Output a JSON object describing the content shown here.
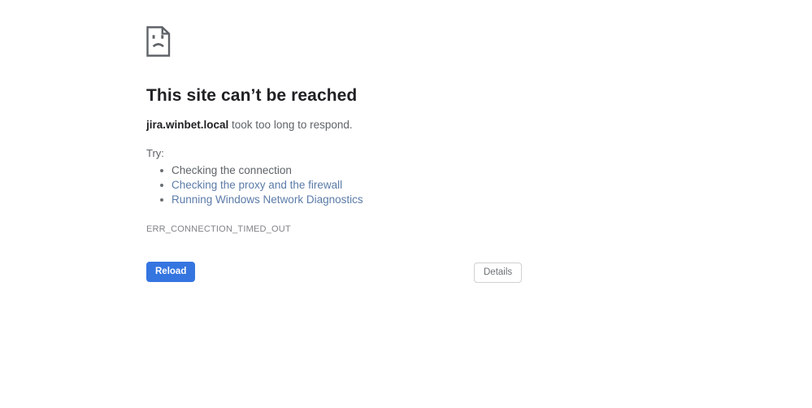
{
  "page": {
    "background_color": "#ffffff",
    "icon": {
      "name": "sad-page-icon",
      "color": "#5f6368"
    }
  },
  "error": {
    "heading": "This site can’t be reached",
    "host": "jira.winbet.local",
    "reason": " took too long to respond.",
    "try_label": "Try:",
    "suggestions": [
      {
        "label": "Checking the connection",
        "is_link": false
      },
      {
        "label": "Checking the proxy and the firewall",
        "is_link": true
      },
      {
        "label": "Running Windows Network Diagnostics",
        "is_link": true
      }
    ],
    "code": "ERR_CONNECTION_TIMED_OUT"
  },
  "buttons": {
    "reload_label": "Reload",
    "details_label": "Details"
  },
  "colors": {
    "heading_text": "#202124",
    "body_text": "#5f6368",
    "link": "#5b7ba8",
    "primary_button_bg": "#3575e0",
    "primary_button_text": "#ffffff",
    "secondary_button_border": "#d0d1d2",
    "secondary_button_text": "#6c7073",
    "error_code_text": "#808387"
  }
}
